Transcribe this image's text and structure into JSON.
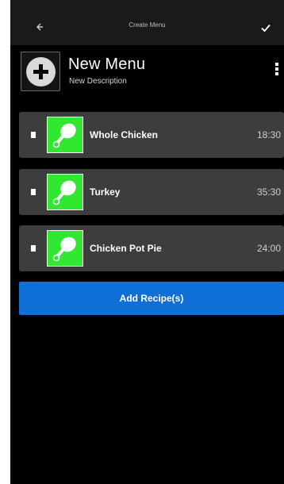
{
  "topbar": {
    "title": "Create Menu",
    "back_icon": "back-arrow-icon",
    "confirm_icon": "check-icon"
  },
  "menu": {
    "name": "New Menu",
    "description": "New Description",
    "add_icon": "plus-circle-icon",
    "more_icon": "more-vert-icon"
  },
  "recipes": [
    {
      "name": "Whole Chicken",
      "time": "18:30",
      "icon": "drumstick-icon"
    },
    {
      "name": "Turkey",
      "time": "35:30",
      "icon": "drumstick-icon"
    },
    {
      "name": "Chicken Pot Pie",
      "time": "24:00",
      "icon": "drumstick-icon"
    }
  ],
  "actions": {
    "add_recipes": "Add Recipe(s)"
  },
  "colors": {
    "background": "#000000",
    "card": "#3d3d3d",
    "thumb_green": "#2fe82f",
    "primary_blue": "#0e6fd6"
  }
}
